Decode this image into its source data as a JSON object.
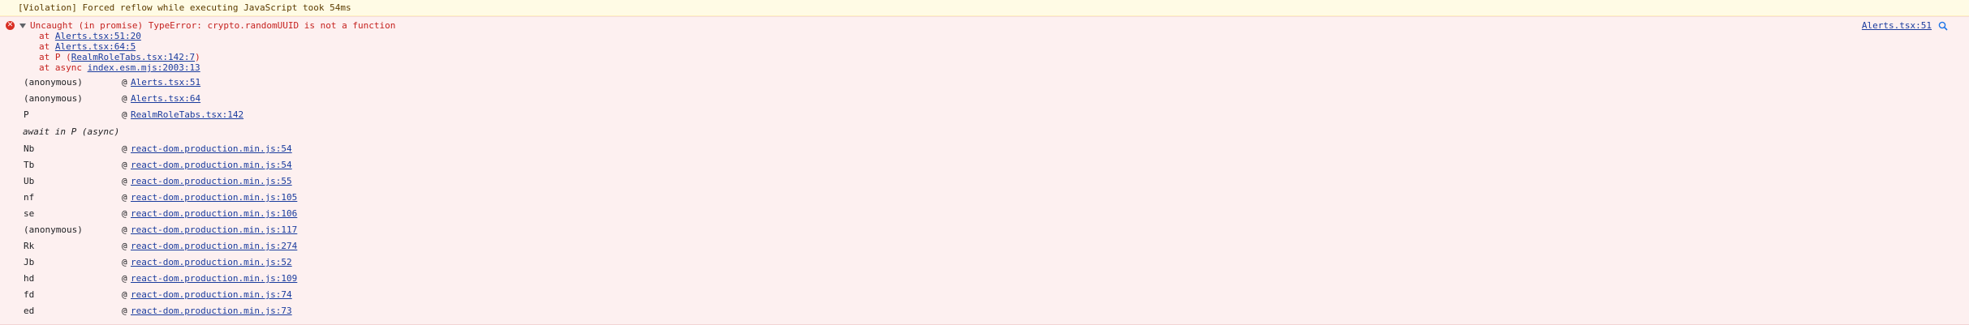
{
  "violation": {
    "text": "[Violation] Forced reflow while executing JavaScript took 54ms"
  },
  "error": {
    "message": "Uncaught (in promise) TypeError: crypto.randomUUID is not a function",
    "source_link": "Alerts.tsx:51",
    "stack": [
      {
        "prefix": "at ",
        "link": "Alerts.tsx:51:20",
        "suffix": ""
      },
      {
        "prefix": "at ",
        "link": "Alerts.tsx:64:5",
        "suffix": ""
      },
      {
        "prefix": "at P (",
        "link": "RealmRoleTabs.tsx:142:7",
        "suffix": ")"
      },
      {
        "prefix": "at async ",
        "link": "index.esm.mjs:2003:13",
        "suffix": ""
      }
    ]
  },
  "trace_top": [
    {
      "fn": "(anonymous)",
      "at": "@",
      "loc": "Alerts.tsx:51"
    },
    {
      "fn": "(anonymous)",
      "at": "@",
      "loc": "Alerts.tsx:64"
    },
    {
      "fn": "P",
      "at": "@",
      "loc": "RealmRoleTabs.tsx:142"
    }
  ],
  "await_label": "await in P (async)",
  "trace_bottom": [
    {
      "fn": "Nb",
      "at": "@",
      "loc": "react-dom.production.min.js:54"
    },
    {
      "fn": "Tb",
      "at": "@",
      "loc": "react-dom.production.min.js:54"
    },
    {
      "fn": "Ub",
      "at": "@",
      "loc": "react-dom.production.min.js:55"
    },
    {
      "fn": "nf",
      "at": "@",
      "loc": "react-dom.production.min.js:105"
    },
    {
      "fn": "se",
      "at": "@",
      "loc": "react-dom.production.min.js:106"
    },
    {
      "fn": "(anonymous)",
      "at": "@",
      "loc": "react-dom.production.min.js:117"
    },
    {
      "fn": "Rk",
      "at": "@",
      "loc": "react-dom.production.min.js:274"
    },
    {
      "fn": "Jb",
      "at": "@",
      "loc": "react-dom.production.min.js:52"
    },
    {
      "fn": "hd",
      "at": "@",
      "loc": "react-dom.production.min.js:109"
    },
    {
      "fn": "fd",
      "at": "@",
      "loc": "react-dom.production.min.js:74"
    },
    {
      "fn": "ed",
      "at": "@",
      "loc": "react-dom.production.min.js:73"
    }
  ],
  "icons": {
    "error": "error-circle-icon",
    "expand": "triangle-down-icon",
    "search": "search-icon"
  },
  "colors": {
    "error_text": "#c5221f",
    "error_bg": "#fdf0f0",
    "warning_bg": "#fffbe5",
    "link": "#1a3c9e"
  }
}
